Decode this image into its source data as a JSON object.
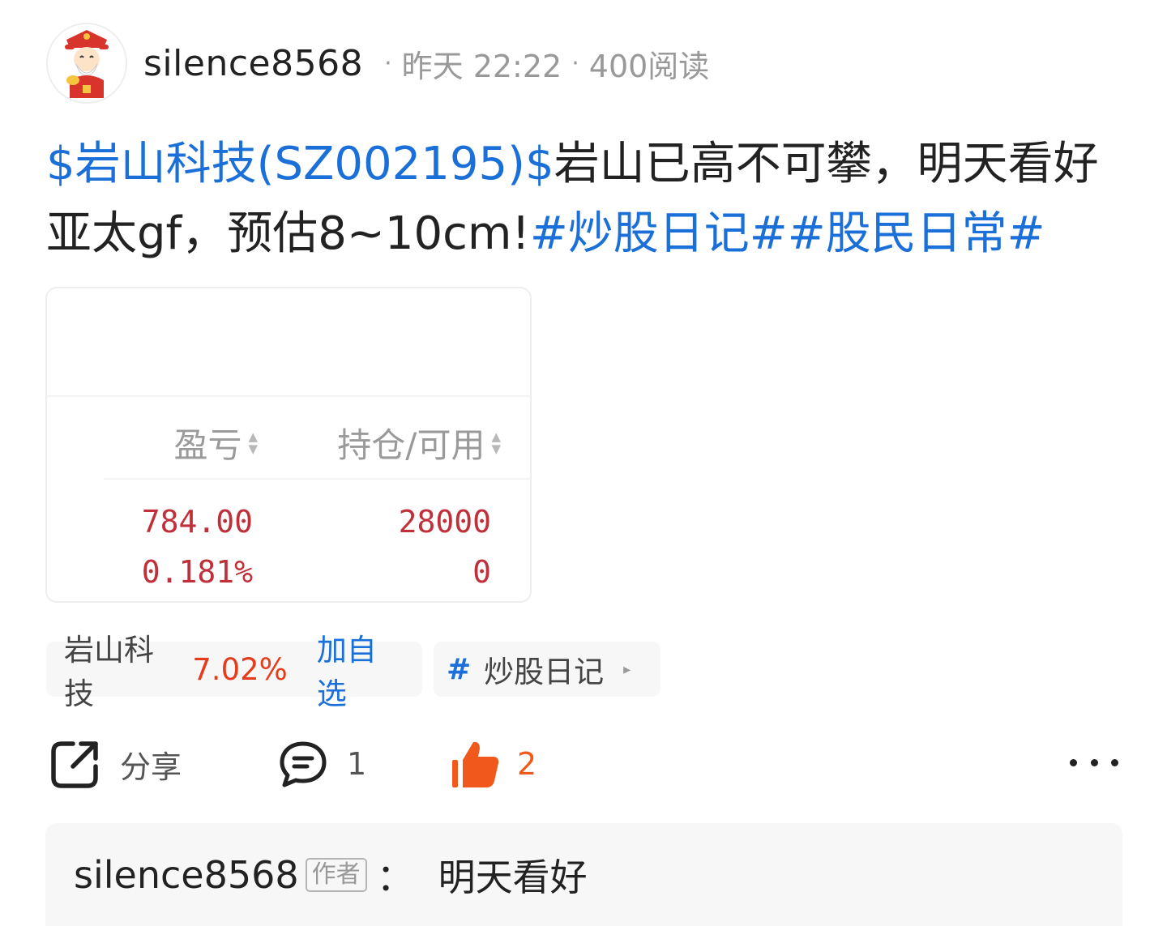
{
  "author": {
    "name": "silence8568",
    "avatar_icon": "caishen-avatar-icon"
  },
  "meta": {
    "time": "昨天 22:22",
    "reads": "400阅读",
    "separator": "·"
  },
  "post": {
    "segments": [
      {
        "text": "$岩山科技(SZ002195)$",
        "type": "link",
        "name": "stock-link"
      },
      {
        "text": "岩山已高不可攀，明天看好亚太gf，预估8~10cm!",
        "type": "text",
        "name": "post-text"
      },
      {
        "text": "#炒股日记#",
        "type": "link",
        "name": "topic-link"
      },
      {
        "text": "#股民日常#",
        "type": "link",
        "name": "topic-link"
      }
    ]
  },
  "image": {
    "headers": {
      "pl": "盈亏",
      "position": "持仓/可用"
    },
    "sort_icons": {
      "up": "▲",
      "down": "▼"
    },
    "pl_values": [
      "784.00",
      "0.181%"
    ],
    "position_values": [
      "28000",
      "0"
    ],
    "value_color": "#c0303a"
  },
  "chips": {
    "stock_name": "岩山科技",
    "stock_change": "7.02%",
    "add_watch": "加自选",
    "topic_hash": "#",
    "topic_label": "炒股日记",
    "topic_arrow": "▸"
  },
  "actions": {
    "share_label": "分享",
    "comment_count": "1",
    "like_count": "2",
    "share_icon": "share-icon",
    "comment_icon": "comment-icon",
    "like_icon": "thumbs-up-icon",
    "more_icon": "more-icon",
    "like_color": "#f0581c"
  },
  "comment": {
    "author": "silence8568",
    "badge": "作者",
    "colon": "：",
    "text": "明天看好"
  },
  "colors": {
    "link": "#1a6fd8",
    "up_red": "#e53c1c",
    "meta_gray": "#999999"
  }
}
